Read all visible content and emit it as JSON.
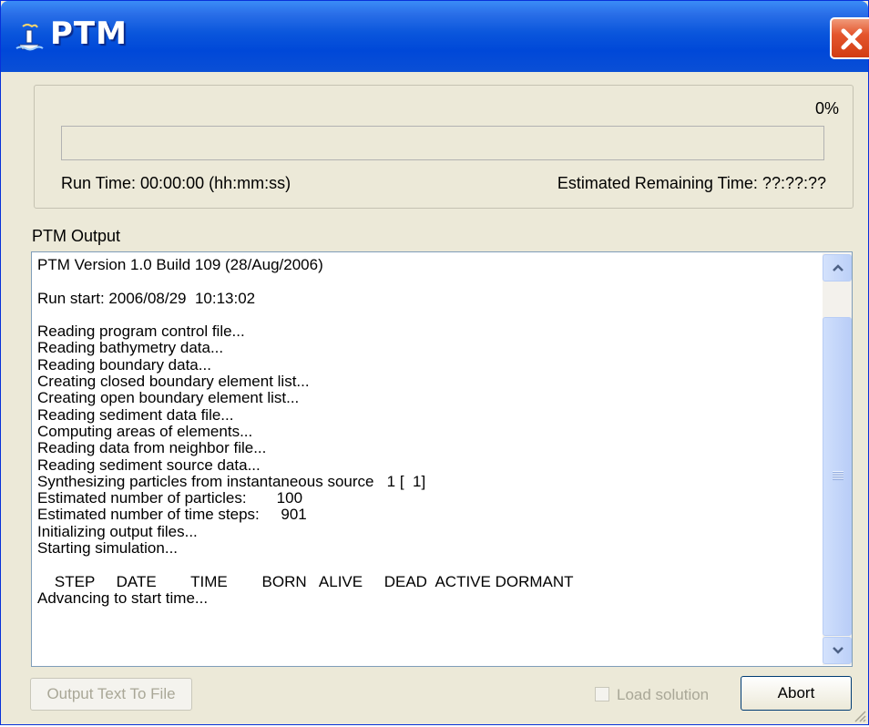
{
  "window": {
    "title": "PTM",
    "icon": "ship-icon",
    "close_icon": "close-icon"
  },
  "progress": {
    "percent_text": "0%",
    "fraction": 0.0,
    "run_time": "Run Time:  00:00:00 (hh:mm:ss)",
    "remaining_time": "Estimated Remaining Time: ??:??:??"
  },
  "output": {
    "label": "PTM Output",
    "text": "PTM Version 1.0 Build 109 (28/Aug/2006)\n\nRun start: 2006/08/29  10:13:02\n\nReading program control file...\nReading bathymetry data...\nReading boundary data...\nCreating closed boundary element list...\nCreating open boundary element list...\nReading sediment data file...\nComputing areas of elements...\nReading data from neighbor file...\nReading sediment source data...\nSynthesizing particles from instantaneous source   1 [  1]\nEstimated number of particles:       100\nEstimated number of time steps:     901\nInitializing output files...\nStarting simulation...\n\n    STEP     DATE        TIME        BORN   ALIVE     DEAD  ACTIVE DORMANT\nAdvancing to start time..."
  },
  "buttons": {
    "output_to_file": "Output Text To File",
    "load_solution": "Load solution",
    "abort": "Abort"
  },
  "colors": {
    "titlebar": "#0a56dc",
    "close": "#d23c12",
    "face": "#ece9d8"
  }
}
